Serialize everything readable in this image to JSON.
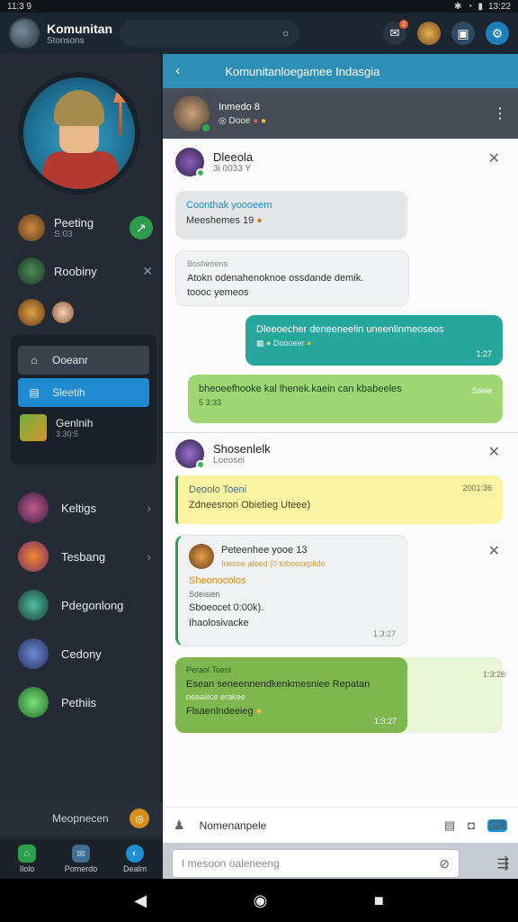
{
  "status_bar": {
    "time_left": "11:3 9",
    "time_right": "13:22"
  },
  "app_bar": {
    "title": "Komunitan",
    "subtitle": "Stonsons",
    "search_icon": "search-icon",
    "badge": "2"
  },
  "sidebar": {
    "profile_rows": [
      {
        "label": "Peeting",
        "sub": "S:03"
      },
      {
        "label": "Roobiny"
      }
    ],
    "menu": [
      {
        "label": "Ooeanr"
      },
      {
        "label": "Sleetih"
      },
      {
        "label": "Genlnih",
        "sub": "3.30:5"
      }
    ],
    "channels": [
      {
        "label": "Keltigs"
      },
      {
        "label": "Tesbang"
      },
      {
        "label": "Pdegonlong"
      },
      {
        "label": "Cedony"
      },
      {
        "label": "Pethiis"
      }
    ],
    "support_label": "Meopnecen",
    "bottom_tabs": [
      "Ilolo",
      "Pomerdo",
      "Dealm"
    ]
  },
  "chat": {
    "top_title": "Komunitanloegamee Indasgia",
    "header_name": "Inmedo 8",
    "header_sub": "Dooe",
    "section1": {
      "name": "Dleeola",
      "sub": "3i 0033  Y",
      "msg1_title": "Coonthak  yoooeem",
      "msg1_body": "Meeshemes 19",
      "msg2_title": "Bosheoens",
      "msg2_body": "Atokn odenahenoknoe ossdande demik.",
      "msg2_body2": "toooc yemeos",
      "msg3_body": "Dleeoecher deneeneelin  uneenlinmeoseos",
      "msg3_meta": "Doooeer",
      "msg3_time": "1:27",
      "msg4_body": "bheoeefhooke kal lhenek.kaein can kbabeeles",
      "msg4_right": "Siieie",
      "msg4_meta": "5 3:33"
    },
    "section2": {
      "name": "Shosenlelk",
      "sub": "Loeosei",
      "msg1_title": "Deoolo Toeni",
      "msg1_time": "2001:36",
      "msg1_body": "Zdneesnon Obietieg Uteee)",
      "msg2_name": "Peteenhee  yooe",
      "msg2_num": "13",
      "msg2_sub": "Inecoe aloed (0 tobooceplido",
      "msg2_title": "Sheonocolos",
      "msg2_l1": "Sdeisien",
      "msg2_l2": "Sboeocet 0:00k).",
      "msg2_l3": "Ihaolosivacke",
      "msg2_time": "1.3:27",
      "msg3_title": "Peraol Toeni",
      "msg3_time": "1:3:26",
      "msg3_l1": "Esean seneennendkenkmesniee Repatan",
      "msg3_l2": "neaaiiice erakee",
      "msg3_l3": "Flsaenlndeeieg",
      "msg3_time2": "1:3:27"
    },
    "tool_label": "Nomenanpele",
    "input_placeholder": "I mesoon oaleneeng"
  }
}
